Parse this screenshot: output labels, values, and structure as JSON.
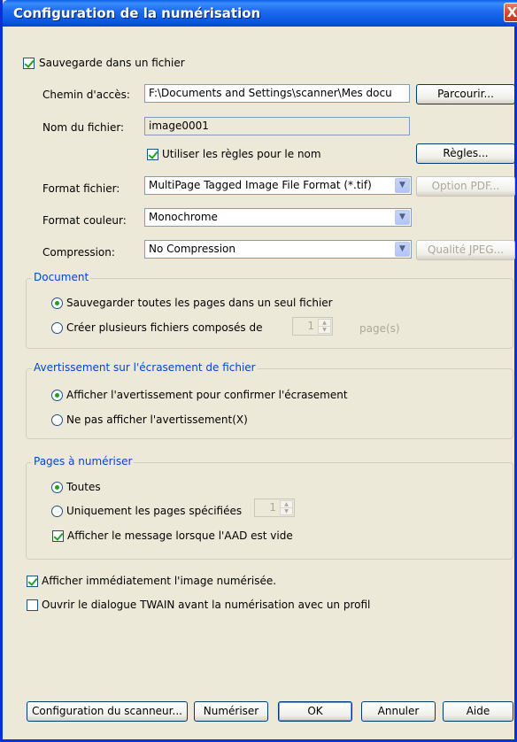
{
  "window": {
    "title": "Configuration de la numérisation",
    "close_glyph": "X"
  },
  "save_to_file": {
    "label": "Sauvegarde dans un fichier",
    "checked": true
  },
  "path": {
    "label": "Chemin d'accès:",
    "value": "F:\\Documents and Settings\\scanner\\Mes docu",
    "browse_label": "Parcourir..."
  },
  "filename": {
    "label": "Nom du fichier:",
    "value": "image0001"
  },
  "naming_rules": {
    "label": "Utiliser les règles pour le nom",
    "checked": true,
    "rules_button": "Règles..."
  },
  "file_format": {
    "label": "Format fichier:",
    "value": "MultiPage Tagged Image File Format (*.tif)",
    "option_button": "Option PDF..."
  },
  "color_format": {
    "label": "Format couleur:",
    "value": "Monochrome"
  },
  "compression": {
    "label": "Compression:",
    "value": "No Compression",
    "quality_button": "Qualité JPEG..."
  },
  "document_group": {
    "title": "Document",
    "single_file": "Sauvegarder toutes les pages dans un seul fichier",
    "multi_files": "Créer plusieurs fichiers composés de",
    "pages_value": "1",
    "pages_unit": "page(s)"
  },
  "overwrite_group": {
    "title": "Avertissement sur l'écrasement de fichier",
    "show_warning": "Afficher l'avertissement pour confirmer l'écrasement",
    "no_warning": "Ne pas afficher l'avertissement(X)"
  },
  "pages_group": {
    "title": "Pages à numériser",
    "all": "Toutes",
    "specified": "Uniquement les pages spécifiées",
    "specified_value": "1",
    "adf_empty": "Afficher le message lorsque l'AAD est vide"
  },
  "show_image": {
    "label": "Afficher immédiatement l'image numérisée.",
    "checked": true
  },
  "twain_dialog": {
    "label": "Ouvrir le dialogue TWAIN avant la numérisation avec un profil",
    "checked": false
  },
  "buttons": {
    "scanner_config": "Configuration du scanneur...",
    "scan": "Numériser",
    "ok": "OK",
    "cancel": "Annuler",
    "help": "Aide"
  },
  "icons": {
    "spin_up": "▲",
    "spin_down": "▼",
    "dropdown": "▼"
  }
}
